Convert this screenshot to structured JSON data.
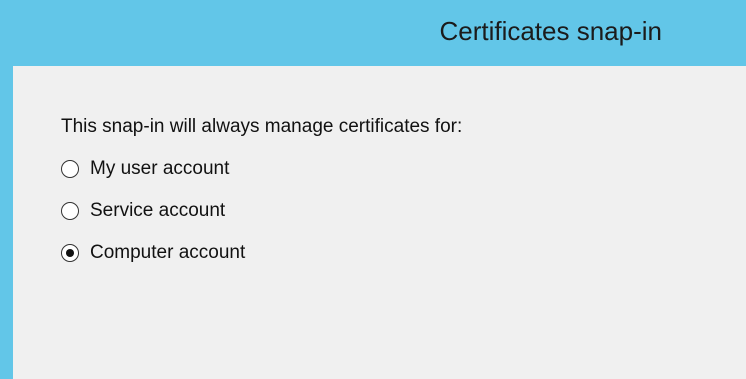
{
  "window": {
    "title": "Certificates snap-in",
    "accent_color": "#62c6e8",
    "background_color": "#f0f0f0"
  },
  "content": {
    "prompt": "This snap-in will always manage certificates for:",
    "options": [
      {
        "label": "My user account",
        "selected": false
      },
      {
        "label": "Service account",
        "selected": false
      },
      {
        "label": "Computer account",
        "selected": true
      }
    ]
  }
}
